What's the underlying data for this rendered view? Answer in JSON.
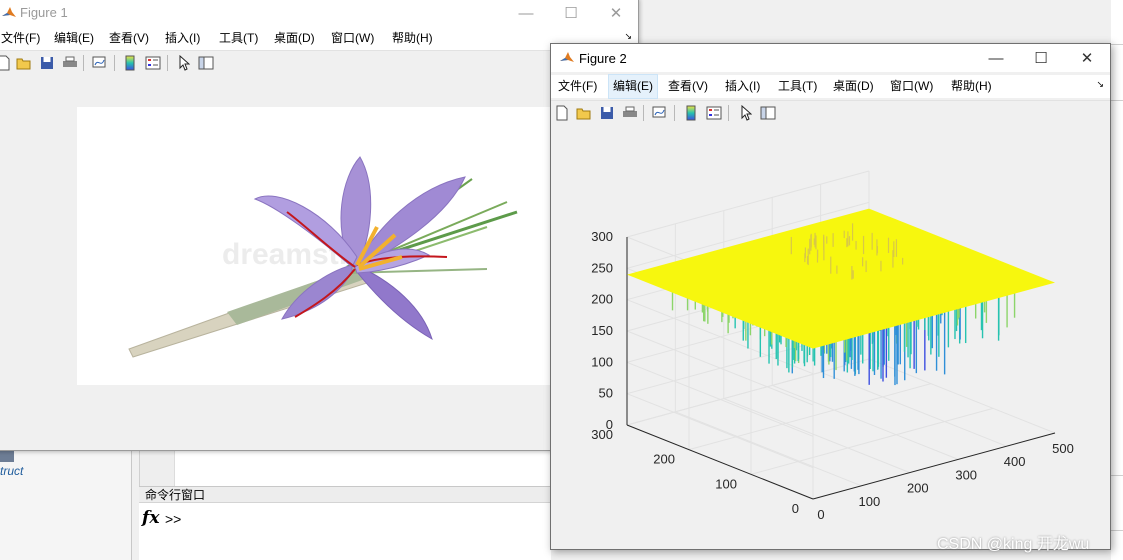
{
  "desktop": {
    "struct_label": "truct",
    "command_window_title": "命令行窗口",
    "fx_label": "fx",
    "prompt": ">>"
  },
  "figure1": {
    "title": "Figure 1",
    "menu": [
      "文件(F)",
      "编辑(E)",
      "查看(V)",
      "插入(I)",
      "工具(T)",
      "桌面(D)",
      "窗口(W)",
      "帮助(H)"
    ],
    "watermark": "dreamstime"
  },
  "figure2": {
    "title": "Figure 2",
    "menu": [
      "文件(F)",
      "编辑(E)",
      "查看(V)",
      "插入(I)",
      "工具(T)",
      "桌面(D)",
      "窗口(W)",
      "帮助(H)"
    ],
    "active_menu": "编辑(E)"
  },
  "toolbar_icons": [
    "new-figure-icon",
    "open-file-icon",
    "save-icon",
    "print-icon",
    "link-plot-icon",
    "insert-colorbar-icon",
    "insert-legend-icon",
    "edit-plot-arrow-icon",
    "property-inspector-icon"
  ],
  "colors": {
    "surface_top": "#f7f70e",
    "colormap_low": "#3d4fe0",
    "colormap_mid": "#26c3b0",
    "colormap_high": "#f0c43a"
  },
  "chart_data": {
    "type": "surface3d",
    "title": "",
    "z_ticks": [
      0,
      50,
      100,
      150,
      200,
      250,
      300
    ],
    "zlim": [
      0,
      300
    ],
    "x_ticks": [
      0,
      100,
      200,
      300,
      400,
      500
    ],
    "xlim": [
      0,
      500
    ],
    "y_ticks": [
      0,
      100,
      200,
      300
    ],
    "ylim": [
      0,
      300
    ],
    "grid": true,
    "colormap": "parula"
  },
  "watermark": "CSDN @king 开龙wu"
}
